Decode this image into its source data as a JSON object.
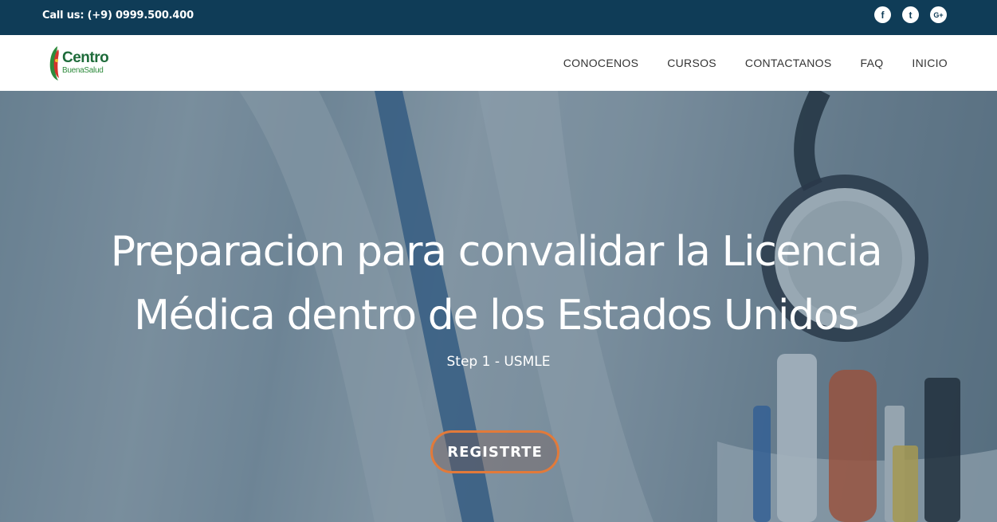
{
  "topbar": {
    "phone": "Call us: (+9) 0999.500.400",
    "social": [
      {
        "icon": "facebook-icon",
        "glyph": "f"
      },
      {
        "icon": "twitter-icon",
        "glyph": "t"
      },
      {
        "icon": "google-plus-icon",
        "glyph": "G+"
      }
    ]
  },
  "logo": {
    "word1": "Centro",
    "word2": "BuenaSalud"
  },
  "nav": {
    "items": [
      "CONOCENOS",
      "CURSOS",
      "CONTACTANOS",
      "FAQ",
      "INICIO"
    ]
  },
  "hero": {
    "headline": "Preparacion para convalidar la Licencia Médica dentro de los Estados Unidos",
    "subtitle": "Step 1 - USMLE",
    "button": "REGISTRTE"
  },
  "colors": {
    "topbar": "#0f3c57",
    "button_border": "#e27a3a",
    "logo_green": "#1e6b3a"
  }
}
